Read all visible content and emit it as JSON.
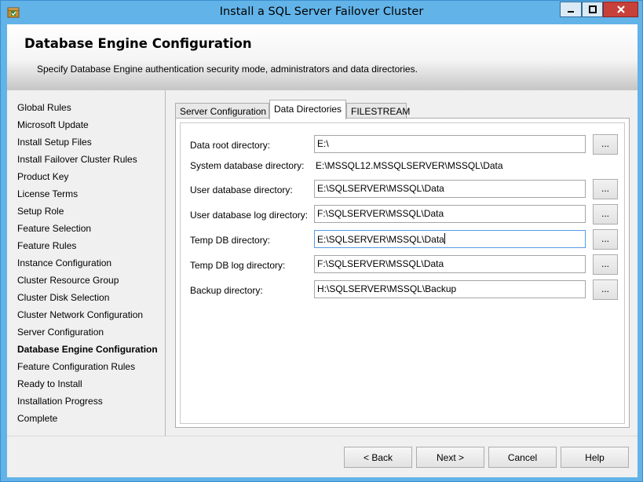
{
  "window": {
    "title": "Install a SQL Server Failover Cluster"
  },
  "header": {
    "title": "Database Engine Configuration",
    "description": "Specify Database Engine authentication security mode, administrators and data directories."
  },
  "steps": [
    {
      "label": "Global Rules",
      "current": false
    },
    {
      "label": "Microsoft Update",
      "current": false
    },
    {
      "label": "Install Setup Files",
      "current": false
    },
    {
      "label": "Install Failover Cluster Rules",
      "current": false
    },
    {
      "label": "Product Key",
      "current": false
    },
    {
      "label": "License Terms",
      "current": false
    },
    {
      "label": "Setup Role",
      "current": false
    },
    {
      "label": "Feature Selection",
      "current": false
    },
    {
      "label": "Feature Rules",
      "current": false
    },
    {
      "label": "Instance Configuration",
      "current": false
    },
    {
      "label": "Cluster Resource Group",
      "current": false
    },
    {
      "label": "Cluster Disk Selection",
      "current": false
    },
    {
      "label": "Cluster Network Configuration",
      "current": false
    },
    {
      "label": "Server Configuration",
      "current": false
    },
    {
      "label": "Database Engine Configuration",
      "current": true
    },
    {
      "label": "Feature Configuration Rules",
      "current": false
    },
    {
      "label": "Ready to Install",
      "current": false
    },
    {
      "label": "Installation Progress",
      "current": false
    },
    {
      "label": "Complete",
      "current": false
    }
  ],
  "tabs": [
    {
      "label": "Server Configuration"
    },
    {
      "label": "Data Directories"
    },
    {
      "label": "FILESTREAM"
    }
  ],
  "directories": {
    "data_root": {
      "label": "Data root directory:",
      "value": "E:\\"
    },
    "system_db": {
      "label": "System database directory:",
      "value": "E:\\MSSQL12.MSSQLSERVER\\MSSQL\\Data"
    },
    "user_db": {
      "label": "User database directory:",
      "value": "E:\\SQLSERVER\\MSSQL\\Data"
    },
    "user_db_log": {
      "label": "User database log directory:",
      "value": "F:\\SQLSERVER\\MSSQL\\Data"
    },
    "temp_db": {
      "label": "Temp DB directory:",
      "value": "E:\\SQLSERVER\\MSSQL\\Data"
    },
    "temp_db_log": {
      "label": "Temp DB log directory:",
      "value": "F:\\SQLSERVER\\MSSQL\\Data"
    },
    "backup": {
      "label": "Backup directory:",
      "value": "H:\\SQLSERVER\\MSSQL\\Backup"
    },
    "browse_label": "..."
  },
  "footer": {
    "back": "< Back",
    "next": "Next >",
    "cancel": "Cancel",
    "help": "Help"
  },
  "colors": {
    "titlebar": "#62b3e8",
    "close_button": "#c7403a",
    "focus_border": "#569de5"
  }
}
